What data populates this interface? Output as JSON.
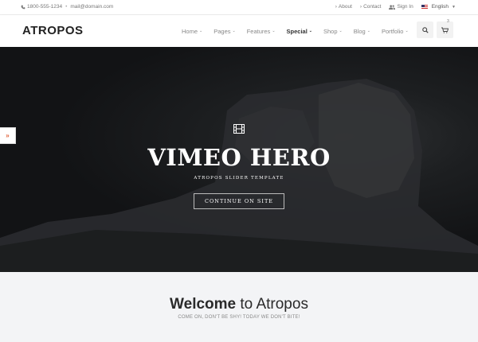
{
  "topbar": {
    "phone": "1800-555-1234",
    "email": "mail@domain.com",
    "separator": "•",
    "about": "About",
    "contact": "Contact",
    "signin": "Sign In",
    "language": "English"
  },
  "header": {
    "logo": "ATROPOS",
    "nav": [
      {
        "label": "Home"
      },
      {
        "label": "Pages"
      },
      {
        "label": "Features"
      },
      {
        "label": "Special"
      },
      {
        "label": "Shop"
      },
      {
        "label": "Blog"
      },
      {
        "label": "Portfolio"
      }
    ],
    "cart_count": "3"
  },
  "hero": {
    "title": "VIMEO HERO",
    "subtitle": "ATROPOS SLIDER TEMPLATE",
    "button": "CONTINUE ON SITE"
  },
  "welcome": {
    "title_bold": "Welcome",
    "title_rest": " to Atropos",
    "tagline": "COME ON, DON'T BE SHY! TODAY WE DON'T BITE!"
  },
  "colors": {
    "accent": "#e0623b",
    "hero_bg": "#1d1f21",
    "welcome_bg": "#f3f4f6"
  }
}
